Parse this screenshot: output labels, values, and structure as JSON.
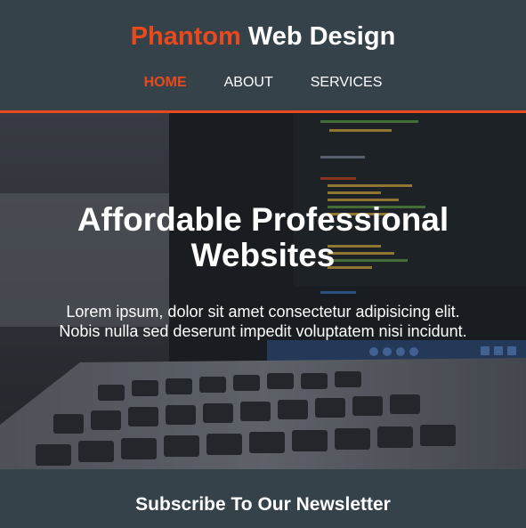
{
  "header": {
    "brand_accent": "Phantom",
    "brand_rest": "Web Design",
    "nav": [
      {
        "label": "HOME",
        "current": true
      },
      {
        "label": "ABOUT",
        "current": false
      },
      {
        "label": "SERVICES",
        "current": false
      }
    ]
  },
  "showcase": {
    "title": "Affordable Professional Websites",
    "text": "Lorem ipsum, dolor sit amet consectetur adipisicing elit. Nobis nulla sed deserunt impedit voluptatem nisi incidunt.",
    "background_image": "laptop-code-photo"
  },
  "newsletter": {
    "title": "Subscribe To Our Newsletter"
  },
  "colors": {
    "accent": "#e8491d",
    "dark": "#35424a",
    "text": "#ffffff"
  }
}
